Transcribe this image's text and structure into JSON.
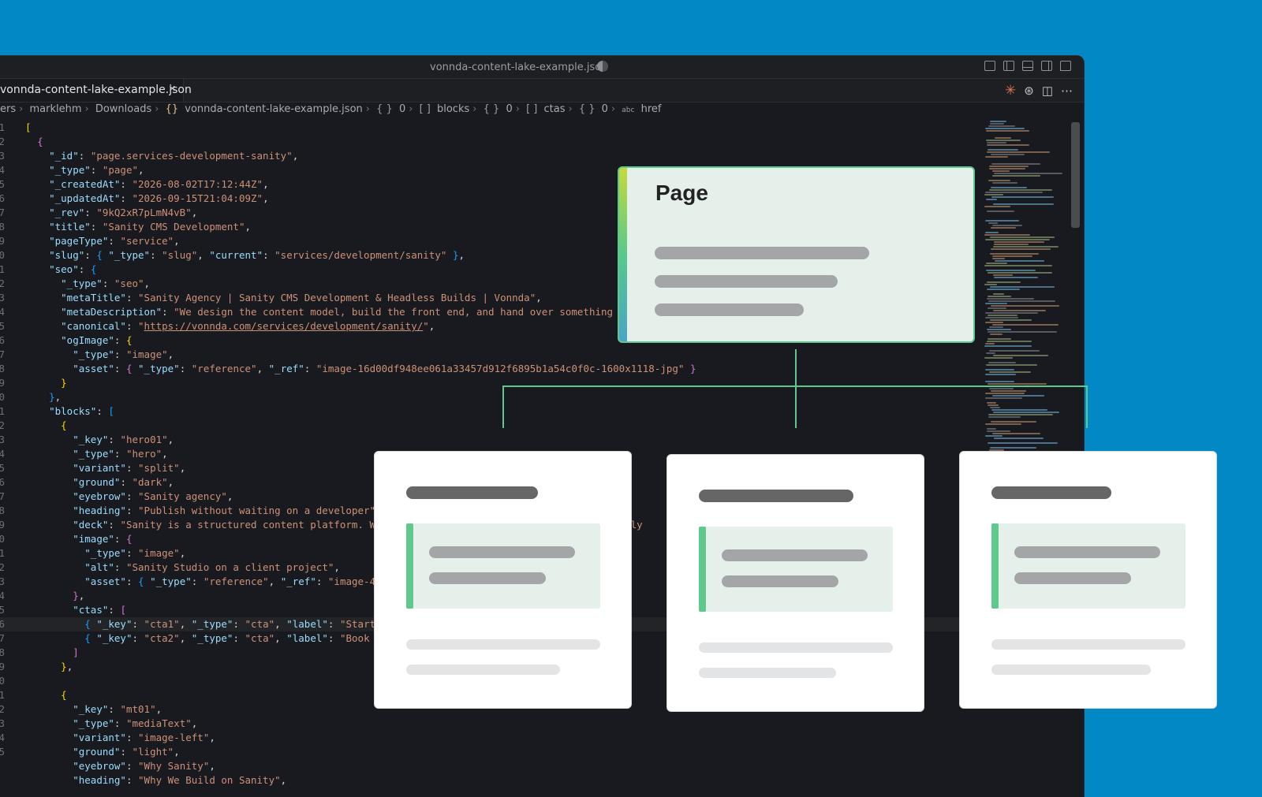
{
  "window": {
    "title": "vonnda-content-lake-example.json"
  },
  "tab": {
    "label": "vonnda-content-lake-example.json",
    "close_glyph": "×"
  },
  "breadcrumb": {
    "items": [
      "ers",
      "marklehm",
      "Downloads",
      "vonnda-content-lake-example.json",
      "0",
      "blocks",
      "0",
      "ctas",
      "0",
      "href"
    ],
    "braces_symbol": "{}",
    "array_symbol": "[ ]",
    "object_symbol": "{ }",
    "string_symbol": "abc"
  },
  "editor": {
    "highlighted_line_number": "6",
    "line_numbers": [
      "1",
      "2",
      "3",
      "4",
      "5",
      "6",
      "7",
      "8",
      "9",
      "0",
      "1",
      "2",
      "3",
      "4",
      "5",
      "6",
      "7",
      "8",
      "9",
      "0",
      "1",
      "2",
      "3",
      "4",
      "5",
      "6",
      "7",
      "8",
      "9",
      "0",
      "1",
      "2",
      "3",
      "4",
      "5",
      "6",
      "7",
      "8",
      "9",
      "0",
      "1",
      "2",
      "3",
      "4",
      "5"
    ]
  },
  "diagram": {
    "root_label": "Page",
    "accent_color": "#5FC98D",
    "card_count": 3
  },
  "colors": {
    "background": "#0289C5",
    "editor_bg": "#181A1F",
    "accent": "#5FC98D"
  }
}
